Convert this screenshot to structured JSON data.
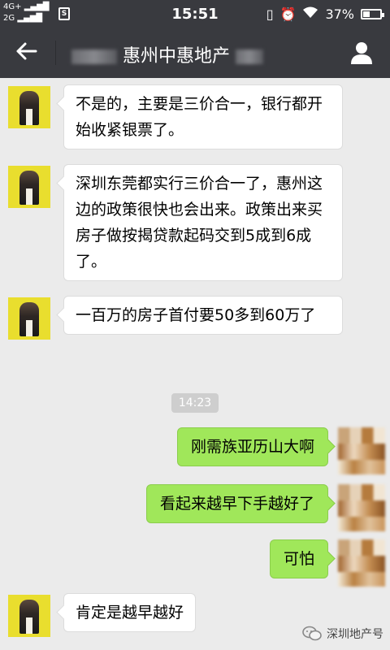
{
  "status_bar": {
    "network_top": "4G+",
    "network_bottom": "2G",
    "sim_label": "S",
    "time": "15:51",
    "battery": "37%",
    "battery_level": 0.37
  },
  "header": {
    "title": "惠州中惠地产"
  },
  "messages": [
    {
      "side": "left",
      "text": "不是的，主要是三价合一，银行都开始收紧银票了。"
    },
    {
      "side": "left",
      "text": "深圳东莞都实行三价合一了，惠州这边的政策很快也会出来。政策出来买房子做按揭贷款起码交到5成到6成了。"
    },
    {
      "side": "left",
      "text": "一百万的房子首付要50多到60万了"
    },
    {
      "side": "right",
      "text": "刚需族亚历山大啊"
    },
    {
      "side": "right",
      "text": "看起来越早下手越好了"
    },
    {
      "side": "right",
      "text": "可怕"
    },
    {
      "side": "left",
      "text": "肯定是越早越好"
    }
  ],
  "timestamp": "14:23",
  "watermark": "深圳地产号",
  "colors": {
    "bar": "#393a3f",
    "chat_bg": "#ebebeb",
    "bubble_out": "#a0e75a",
    "bubble_in": "#ffffff"
  },
  "icons": [
    "back-arrow-icon",
    "profile-icon",
    "wifi-icon",
    "alarm-icon",
    "vibrate-icon",
    "wechat-icon"
  ]
}
